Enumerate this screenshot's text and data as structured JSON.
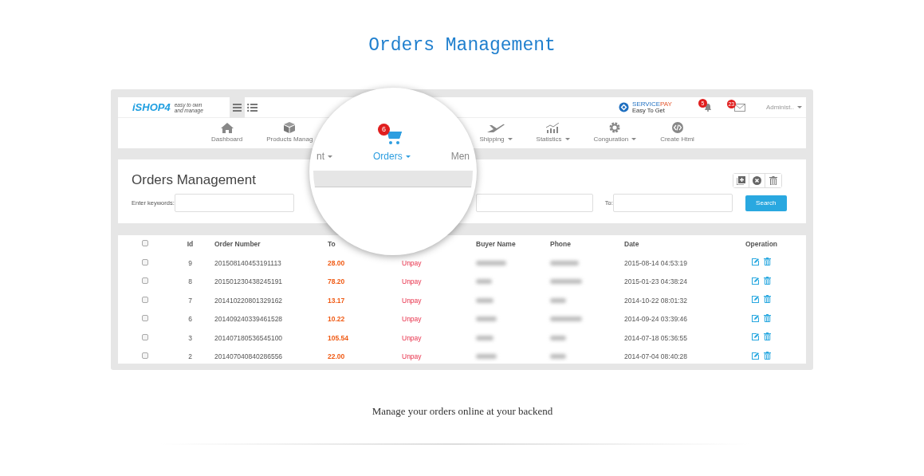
{
  "page": {
    "title": "Orders Management",
    "caption": "Manage your orders online at your backend"
  },
  "topbar": {
    "logo": "iSHOP4",
    "tagline": [
      "easy to own",
      "and manage"
    ],
    "view_toggles": [
      {
        "kind": "lines",
        "selected": true
      },
      {
        "kind": "list",
        "selected": false
      }
    ],
    "brand": {
      "name_main": "SERVICE",
      "name_accent": "PAY",
      "slogan": "Easy To Get"
    },
    "notifications": "5",
    "messages": "23",
    "user": "Administ.."
  },
  "nav": [
    {
      "label": "Dashboard",
      "kind": "home",
      "dropdown": false
    },
    {
      "label": "Products Manag",
      "kind": "box",
      "dropdown": false
    },
    {
      "label": "Shipping",
      "kind": "plane",
      "dropdown": true
    },
    {
      "label": "Statistics",
      "kind": "chart",
      "dropdown": true
    },
    {
      "label": "Conguration",
      "kind": "gear",
      "dropdown": true
    },
    {
      "label": "Create Html",
      "kind": "code",
      "dropdown": false
    }
  ],
  "magnifier": {
    "items": [
      {
        "label": "nt",
        "dropdown": true,
        "selected": false
      },
      {
        "label": "Orders",
        "dropdown": true,
        "selected": true,
        "badge": "6",
        "kind": "cart"
      },
      {
        "label": "Men",
        "dropdown": false,
        "selected": false
      }
    ]
  },
  "panel": {
    "title": "Orders Management",
    "tools": [
      {
        "kind": "add"
      },
      {
        "kind": "close"
      },
      {
        "kind": "delete"
      }
    ],
    "keyword_label": "Enter keywords:",
    "to_label": "To:",
    "search_button": "Search"
  },
  "table": {
    "select_all": {
      "checked": false
    },
    "columns": [
      "Id",
      "Order Number",
      "To",
      "Buyer Name",
      "Phone",
      "Date",
      "Operation"
    ],
    "rows": [
      {
        "checked": false,
        "id": "9",
        "order_number": "201508140453191113",
        "total": "28.00",
        "status": "Unpay",
        "date": "2015-08-14 04:53:19"
      },
      {
        "checked": false,
        "id": "8",
        "order_number": "201501230438245191",
        "total": "78.20",
        "status": "Unpay",
        "date": "2015-01-23 04:38:24"
      },
      {
        "checked": false,
        "id": "7",
        "order_number": "201410220801329162",
        "total": "13.17",
        "status": "Unpay",
        "date": "2014-10-22 08:01:32"
      },
      {
        "checked": false,
        "id": "6",
        "order_number": "201409240339461528",
        "total": "10.22",
        "status": "Unpay",
        "date": "2014-09-24 03:39:46"
      },
      {
        "checked": false,
        "id": "3",
        "order_number": "201407180536545100",
        "total": "105.54",
        "status": "Unpay",
        "date": "2014-07-18 05:36:55"
      },
      {
        "checked": false,
        "id": "2",
        "order_number": "201407040840286556",
        "total": "22.00",
        "status": "Unpay",
        "date": "2014-07-04 08:40:28"
      }
    ]
  }
}
